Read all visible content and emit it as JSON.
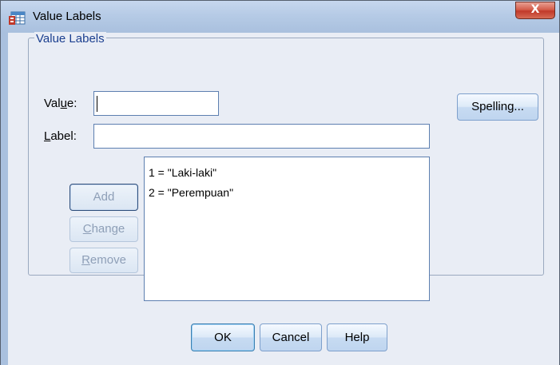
{
  "window": {
    "title": "Value Labels",
    "close_label": "X"
  },
  "group": {
    "legend": "Value Labels"
  },
  "fields": {
    "value": {
      "label_pre": "Val",
      "label_mnemonic": "u",
      "label_post": "e:",
      "value": ""
    },
    "label": {
      "label_mnemonic": "L",
      "label_post": "abel:",
      "value": ""
    }
  },
  "list": {
    "items": [
      "1 = \"Laki-laki\"",
      "2 = \"Perempuan\""
    ]
  },
  "buttons": {
    "spelling": "Spelling...",
    "add": "Add",
    "change": {
      "mnemonic": "C",
      "rest": "hange"
    },
    "remove": {
      "mnemonic": "R",
      "rest": "emove"
    },
    "ok": "OK",
    "cancel": "Cancel",
    "help": "Help"
  }
}
